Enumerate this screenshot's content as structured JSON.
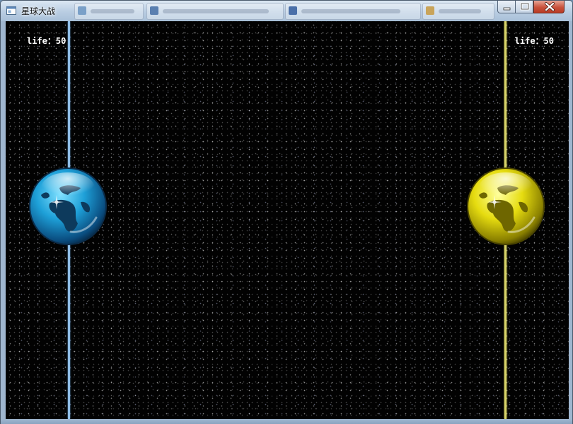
{
  "window": {
    "title": "星球大战",
    "background_tabs": [
      {
        "color": "#7aa0c8"
      },
      {
        "color": "#5a7fb0"
      },
      {
        "color": "#4a6fa8"
      },
      {
        "color": "#c9a45a"
      }
    ]
  },
  "controls": {
    "minimize": "minimize-icon",
    "maximize": "maximize-icon",
    "close": "close-icon"
  },
  "game": {
    "background": "#020202",
    "left_player": {
      "life_text": "life：50",
      "planet_color": "#29a8e0",
      "lane_color": "#8fbde6"
    },
    "right_player": {
      "life_text": "life：50",
      "planet_color": "#e8e020",
      "lane_color": "#d8d46a"
    }
  }
}
